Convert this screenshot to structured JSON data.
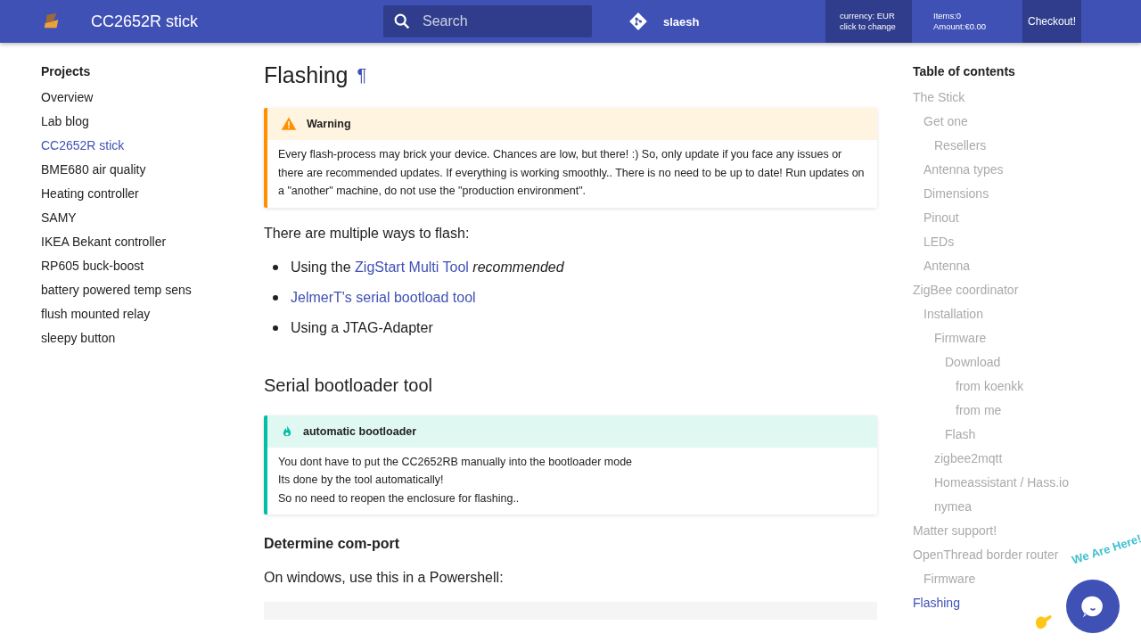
{
  "header": {
    "title": "CC2652R stick",
    "search": {
      "placeholder": "Search"
    },
    "repo": "slaesh",
    "currency": [
      "currency: EUR",
      "click to change"
    ],
    "cart": [
      "Items:0",
      "Amount:€0.00"
    ],
    "checkout": "Checkout!"
  },
  "nav": {
    "title": "Projects",
    "items": [
      {
        "label": "Overview",
        "selected": false
      },
      {
        "label": "Lab blog",
        "selected": false
      },
      {
        "label": "CC2652R stick",
        "selected": true
      },
      {
        "label": "BME680 air quality",
        "selected": false
      },
      {
        "label": "Heating controller",
        "selected": false
      },
      {
        "label": "SAMY",
        "selected": false
      },
      {
        "label": "IKEA Bekant controller",
        "selected": false
      },
      {
        "label": "RP605 buck-boost",
        "selected": false
      },
      {
        "label": "battery powered temp sens",
        "selected": false
      },
      {
        "label": "flush mounted relay",
        "selected": false
      },
      {
        "label": "sleepy button",
        "selected": false
      }
    ]
  },
  "content": [
    {
      "kind": "h1",
      "text": "Flashing",
      "anchor": "¶"
    },
    {
      "kind": "warning",
      "title": "Warning",
      "lines": [
        "Every flash-process may brick your device. Chances are low, but there! :) So, only update if you face any issues or there are recommended updates. If everything is working smoothly.. There is no need to be up to date! Run updates on a \"another\" machine, do not use the \"production environment\"."
      ]
    },
    {
      "kind": "p",
      "text": "There are multiple ways to flash:"
    },
    {
      "kind": "list",
      "items": [
        [
          {
            "kind": "text",
            "text": "Using the"
          },
          {
            "kind": "link",
            "text": "ZigStart Multi Tool"
          },
          {
            "kind": "italic",
            "text": "recommended"
          }
        ],
        [
          {
            "kind": "link",
            "text": "JelmerT's serial bootload tool"
          }
        ],
        [
          {
            "kind": "text",
            "text": "Using a JTAG-Adapter"
          }
        ]
      ]
    },
    {
      "kind": "h2",
      "text": "Serial bootloader tool"
    },
    {
      "kind": "tip",
      "title": "automatic bootloader",
      "lines": [
        "You dont have to put the CC2652RB manually into the bootloader mode",
        "Its done by the tool automatically!",
        "So no need to reopen the enclosure for flashing.."
      ]
    },
    {
      "kind": "h4",
      "text": "Determine com-port"
    },
    {
      "kind": "p",
      "text": "On windows, use this in a Powershell:"
    },
    {
      "kind": "code"
    }
  ],
  "toc": {
    "title": "Table of contents",
    "items": [
      {
        "label": "The Stick",
        "selected": false,
        "children": [
          {
            "label": "Get one",
            "selected": false,
            "children": [
              {
                "label": "Resellers",
                "selected": false
              }
            ]
          },
          {
            "label": "Antenna types",
            "selected": false
          },
          {
            "label": "Dimensions",
            "selected": false
          },
          {
            "label": "Pinout",
            "selected": false
          },
          {
            "label": "LEDs",
            "selected": false
          },
          {
            "label": "Antenna",
            "selected": false
          }
        ]
      },
      {
        "label": "ZigBee coordinator",
        "selected": false,
        "children": [
          {
            "label": "Installation",
            "selected": false,
            "children": [
              {
                "label": "Firmware",
                "selected": false,
                "children": [
                  {
                    "label": "Download",
                    "selected": false,
                    "children": [
                      {
                        "label": "from koenkk",
                        "selected": false
                      },
                      {
                        "label": "from me",
                        "selected": false
                      }
                    ]
                  },
                  {
                    "label": "Flash",
                    "selected": false
                  }
                ]
              },
              {
                "label": "zigbee2mqtt",
                "selected": false
              },
              {
                "label": "Homeassistant / Hass.io",
                "selected": false
              },
              {
                "label": "nymea",
                "selected": false
              }
            ]
          }
        ]
      },
      {
        "label": "Matter support!",
        "selected": false
      },
      {
        "label": "OpenThread border router",
        "selected": false,
        "children": [
          {
            "label": "Firmware",
            "selected": false
          }
        ]
      },
      {
        "label": "Flashing",
        "selected": true
      }
    ]
  },
  "chat": {
    "label": "We Are Here!"
  }
}
